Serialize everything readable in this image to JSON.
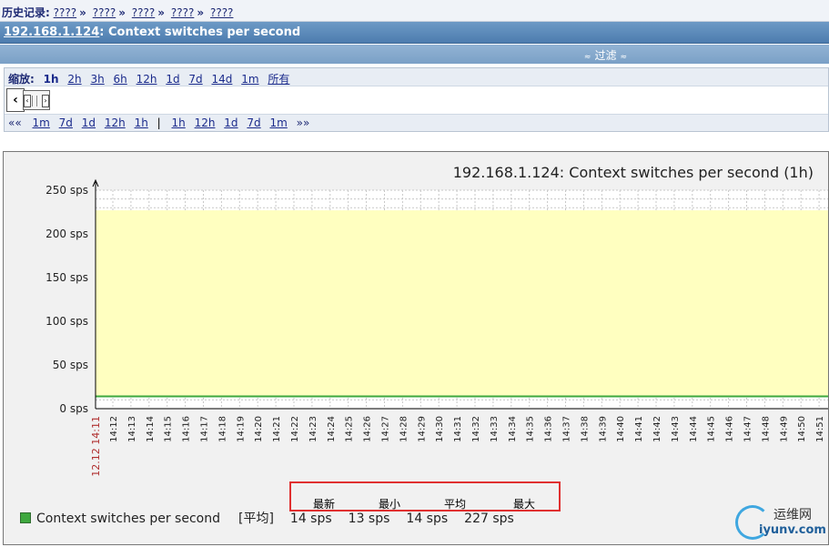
{
  "history": {
    "label": "历史记录:",
    "crumbs": [
      "????",
      "????",
      "????",
      "????",
      "????"
    ],
    "separator": "»"
  },
  "header": {
    "host": "192.168.1.124",
    "title_rest": ": Context switches per second"
  },
  "filter": {
    "label": "过滤",
    "arrow": "≈"
  },
  "zoom": {
    "label": "缩放:",
    "items": [
      "1h",
      "2h",
      "3h",
      "6h",
      "12h",
      "1d",
      "7d",
      "14d",
      "1m",
      "所有"
    ],
    "active": "1h"
  },
  "nav": {
    "back_marker": "««",
    "back": [
      "1m",
      "7d",
      "1d",
      "12h",
      "1h"
    ],
    "pipe": "|",
    "forward": [
      "1h",
      "12h",
      "1d",
      "7d",
      "1m"
    ],
    "forward_marker": "»»"
  },
  "chart_data": {
    "type": "area",
    "title": "192.168.1.124: Context switches per second (1h)",
    "ylim": [
      0,
      250
    ],
    "ytick_labels": [
      "250 sps",
      "200 sps",
      "150 sps",
      "100 sps",
      "50 sps",
      "0 sps"
    ],
    "y_ticks": [
      250,
      200,
      150,
      100,
      50,
      0
    ],
    "start_label": "12.12 14:11",
    "x_categories": [
      "14:12",
      "14:13",
      "14:14",
      "14:15",
      "14:16",
      "14:17",
      "14:18",
      "14:19",
      "14:20",
      "14:21",
      "14:22",
      "14:23",
      "14:24",
      "14:25",
      "14:26",
      "14:27",
      "14:28",
      "14:29",
      "14:30",
      "14:31",
      "14:32",
      "14:33",
      "14:34",
      "14:35",
      "14:36",
      "14:37",
      "14:38",
      "14:39",
      "14:40",
      "14:41",
      "14:42",
      "14:43",
      "14:44",
      "14:45",
      "14:46",
      "14:47",
      "14:48",
      "14:49",
      "14:50",
      "14:51"
    ],
    "series": [
      {
        "name": "Context switches per second",
        "line_value": 14,
        "max_value": 227,
        "color": "#3ea83e",
        "fill": "#ffffc0"
      }
    ],
    "grid": true,
    "legend": "bottom-left"
  },
  "legend": {
    "series_name": "Context switches per second",
    "tag": "[平均]",
    "last": "14 sps",
    "min": "13 sps",
    "avg": "14 sps",
    "max": "227 sps"
  },
  "stat_headers": [
    "最新",
    "最小",
    "平均",
    "最大"
  ],
  "watermark": {
    "cn": "运维网",
    "en": "iyunv.com"
  }
}
